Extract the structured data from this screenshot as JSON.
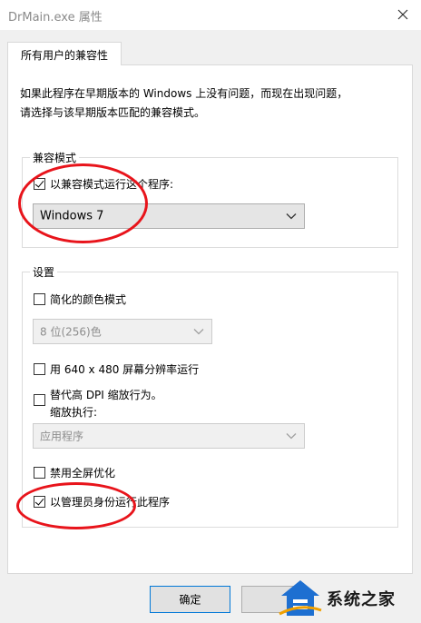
{
  "window": {
    "title": "DrMain.exe 属性"
  },
  "tabs": [
    {
      "label": "所有用户的兼容性",
      "active": true
    }
  ],
  "description": {
    "line1": "如果此程序在早期版本的 Windows 上没有问题，而现在出现问题，",
    "line2": "请选择与该早期版本匹配的兼容模式。"
  },
  "compat_mode": {
    "group_title": "兼容模式",
    "checkbox_label": "以兼容模式运行这个程序:",
    "checked": true,
    "selected_os": "Windows 7"
  },
  "settings": {
    "group_title": "设置",
    "reduced_color": {
      "label": "简化的颜色模式",
      "checked": false
    },
    "color_depth": {
      "value": "8 位(256)色",
      "disabled": true
    },
    "res_640": {
      "label": "用 640 x 480 屏幕分辨率运行",
      "checked": false
    },
    "dpi_override": {
      "label_line1": "替代高 DPI 缩放行为。",
      "label_line2": "缩放执行:",
      "checked": false
    },
    "dpi_scaling": {
      "value": "应用程序",
      "disabled": true
    },
    "fullscreen_opt": {
      "label": "禁用全屏优化",
      "checked": false
    },
    "run_as_admin": {
      "label": "以管理员身份运行此程序",
      "checked": true
    }
  },
  "buttons": {
    "ok": "确定"
  },
  "watermark": {
    "text": "系统之家"
  },
  "colors": {
    "annotation": "#e8141b",
    "focus_border": "#0078d7",
    "panel": "#ffffff",
    "dialog_bg": "#f0f0f0"
  }
}
